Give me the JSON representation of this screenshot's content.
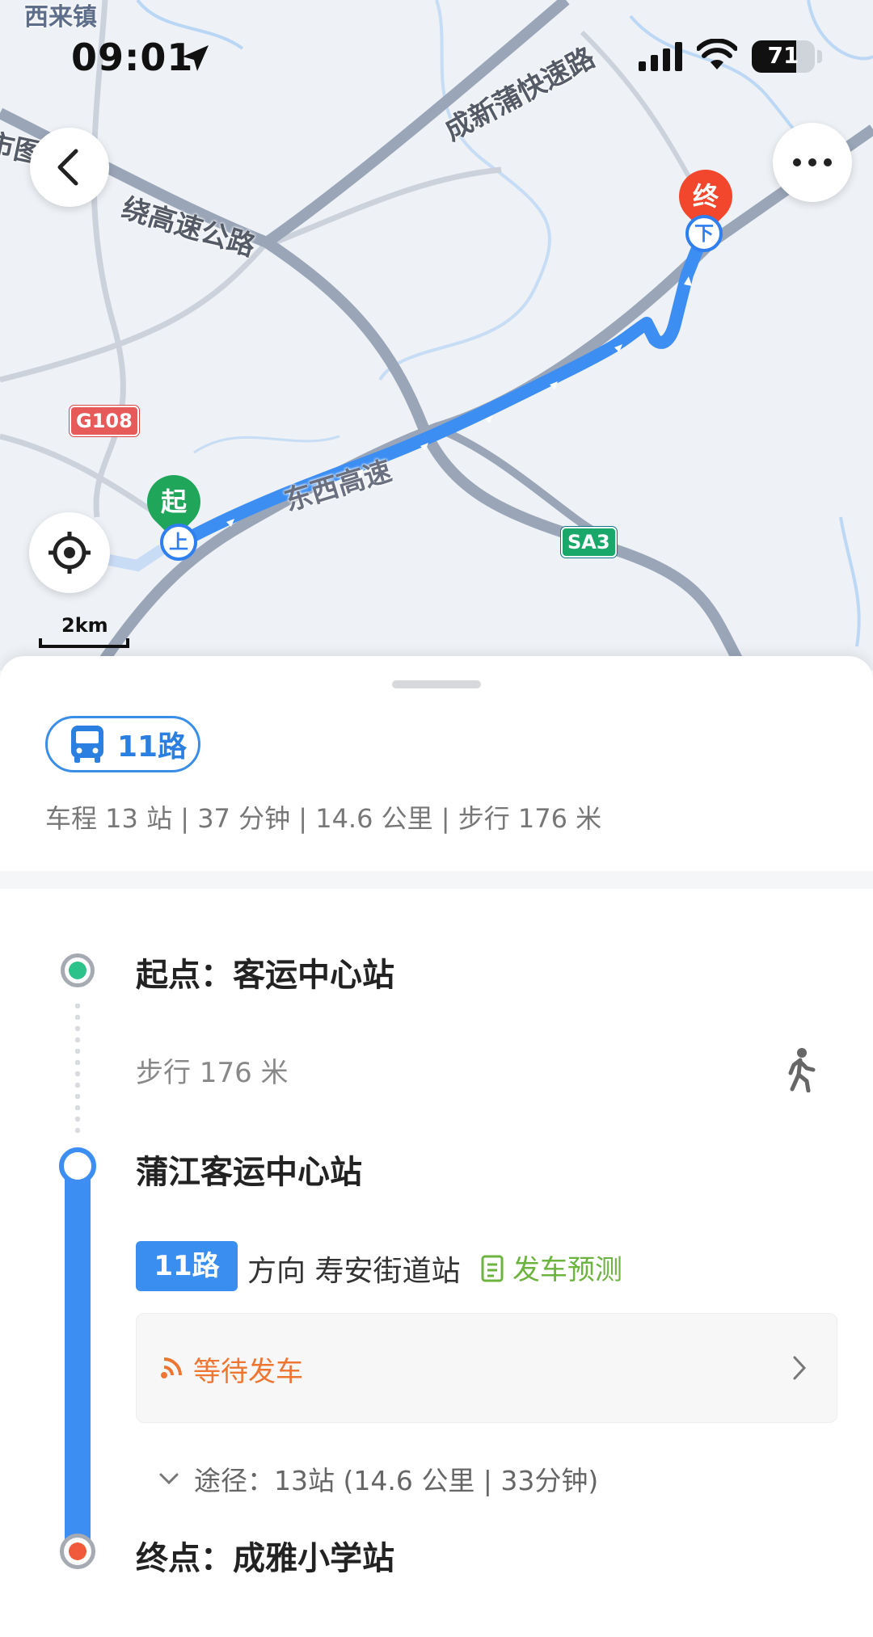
{
  "status_bar": {
    "time": "09:01",
    "battery": "71",
    "icons": [
      "location-arrow-icon",
      "signal-icon",
      "wifi-icon",
      "battery-icon"
    ]
  },
  "map": {
    "town_label": "西来镇",
    "highway_labels": [
      "市图",
      "绕高速公路",
      "成新蒲快速路",
      "东西高速"
    ],
    "shields": [
      "G108",
      "SA3"
    ],
    "start_pin": "起",
    "end_pin": "终",
    "board_marker": "上",
    "alight_marker": "下",
    "scale": "2km",
    "buttons": [
      "back-icon",
      "more-icon",
      "locate-icon"
    ]
  },
  "route": {
    "line_name": "11路",
    "summary": "车程 13 站 | 37 分钟 | 14.6 公里 | 步行 176 米"
  },
  "timeline": {
    "start_label": "起点：客运中心站",
    "walk_text": "步行 176 米",
    "board_stop": "蒲江客运中心站",
    "line_badge": "11路",
    "direction": "方向 寿安街道站",
    "forecast": "发车预测",
    "wait_status": "等待发车",
    "via": "途径：13站 (14.6 公里 | 33分钟)",
    "end_label": "终点：成雅小学站"
  },
  "colors": {
    "route_blue": "#3c8ef3",
    "start_green": "#1fa65a",
    "end_red": "#f2472d",
    "forecast_green": "#6db33f",
    "wait_orange": "#ee7532"
  }
}
